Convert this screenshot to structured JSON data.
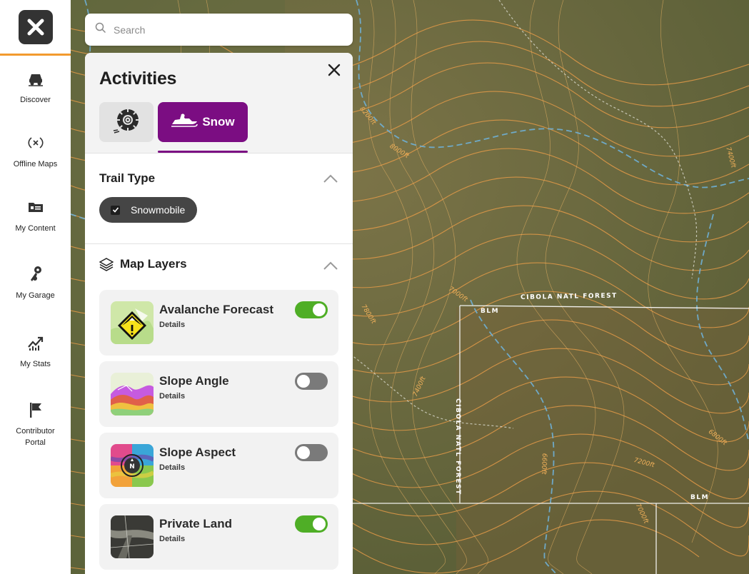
{
  "nav": {
    "items": [
      {
        "label": "Discover",
        "icon": "discover-icon"
      },
      {
        "label": "Offline Maps",
        "icon": "offline-maps-icon"
      },
      {
        "label": "My Content",
        "icon": "my-content-icon"
      },
      {
        "label": "My Garage",
        "icon": "garage-keys-icon"
      },
      {
        "label": "My Stats",
        "icon": "stats-icon"
      },
      {
        "label": "Contributor",
        "label2": "Portal",
        "icon": "contributor-flag-icon"
      }
    ]
  },
  "search": {
    "placeholder": "Search"
  },
  "panel": {
    "title": "Activities",
    "activities": [
      {
        "label": "",
        "icon": "offroad-tire-icon",
        "selected": false
      },
      {
        "label": "Snow",
        "icon": "snowmobile-icon",
        "selected": true
      }
    ],
    "trail_type": {
      "title": "Trail Type",
      "chips": [
        {
          "label": "Snowmobile",
          "checked": true
        }
      ]
    },
    "map_layers": {
      "title": "Map Layers",
      "layers": [
        {
          "name": "Avalanche Forecast",
          "details": "Details",
          "enabled": true
        },
        {
          "name": "Slope Angle",
          "details": "Details",
          "enabled": false
        },
        {
          "name": "Slope Aspect",
          "details": "Details",
          "enabled": false
        },
        {
          "name": "Private Land",
          "details": "Details",
          "enabled": true
        }
      ]
    }
  },
  "map": {
    "labels": {
      "cibola_top": "CIBOLA NATL FOREST",
      "cibola_vertical": "CIBOLA NATL FOREST",
      "blm_top": "BLM",
      "blm_bottom": "BLM",
      "contour_8200": "8200ft",
      "contour_8000": "8000ft",
      "contour_7400_right": "7400ft",
      "contour_7000_a": "7000ft",
      "contour_7800": "7800ft",
      "contour_7400_b": "7400ft",
      "contour_6800": "6800ft",
      "contour_7200": "7200ft",
      "contour_6600": "6600ft",
      "contour_7000_b": "7000ft"
    }
  },
  "colors": {
    "accent_purple": "#7b0d82",
    "toggle_on": "#4fae26",
    "nav_highlight": "#f29a2e"
  }
}
